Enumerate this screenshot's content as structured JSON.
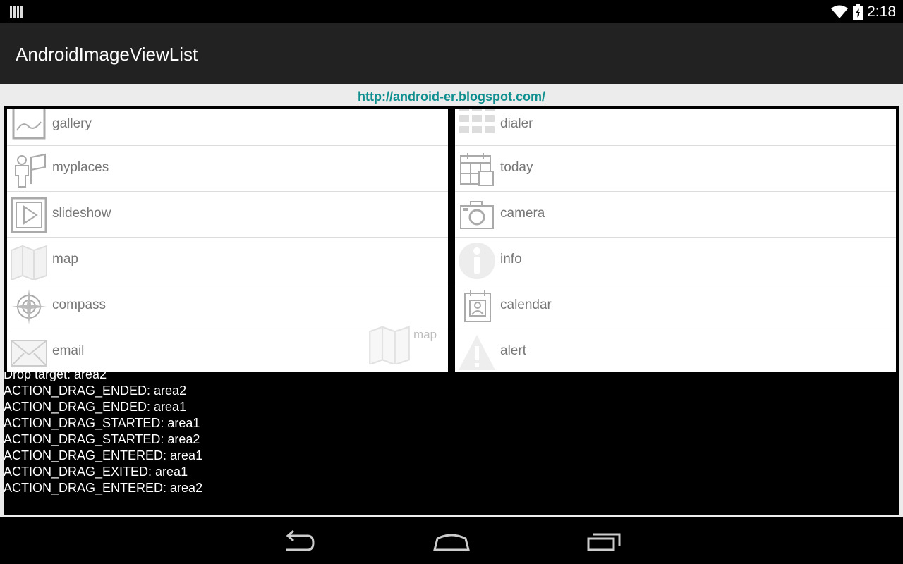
{
  "status": {
    "time": "2:18"
  },
  "app": {
    "title": "AndroidImageViewList"
  },
  "link": {
    "text": "http://android-er.blogspot.com/"
  },
  "left_list": [
    {
      "label": "gallery",
      "icon": "gallery-icon"
    },
    {
      "label": "myplaces",
      "icon": "myplaces-icon"
    },
    {
      "label": "slideshow",
      "icon": "slideshow-icon"
    },
    {
      "label": "map",
      "icon": "map-icon"
    },
    {
      "label": "compass",
      "icon": "compass-icon"
    },
    {
      "label": "email",
      "icon": "email-icon"
    }
  ],
  "right_list": [
    {
      "label": "dialer",
      "icon": "dialer-icon"
    },
    {
      "label": "today",
      "icon": "today-icon"
    },
    {
      "label": "camera",
      "icon": "camera-icon"
    },
    {
      "label": "info",
      "icon": "info-icon"
    },
    {
      "label": "calendar",
      "icon": "calendar-icon"
    },
    {
      "label": "alert",
      "icon": "alert-icon"
    }
  ],
  "drag_shadow": {
    "label": "map"
  },
  "log": [
    "Drop target: area2",
    "ACTION_DRAG_ENDED: area2",
    "ACTION_DRAG_ENDED: area1",
    "ACTION_DRAG_STARTED: area1",
    "ACTION_DRAG_STARTED: area2",
    "ACTION_DRAG_ENTERED: area1",
    "ACTION_DRAG_EXITED: area1",
    "ACTION_DRAG_ENTERED: area2"
  ],
  "colors": {
    "link": "#0f8f8f",
    "actionbar": "#222222",
    "content_bg": "#ececec"
  }
}
